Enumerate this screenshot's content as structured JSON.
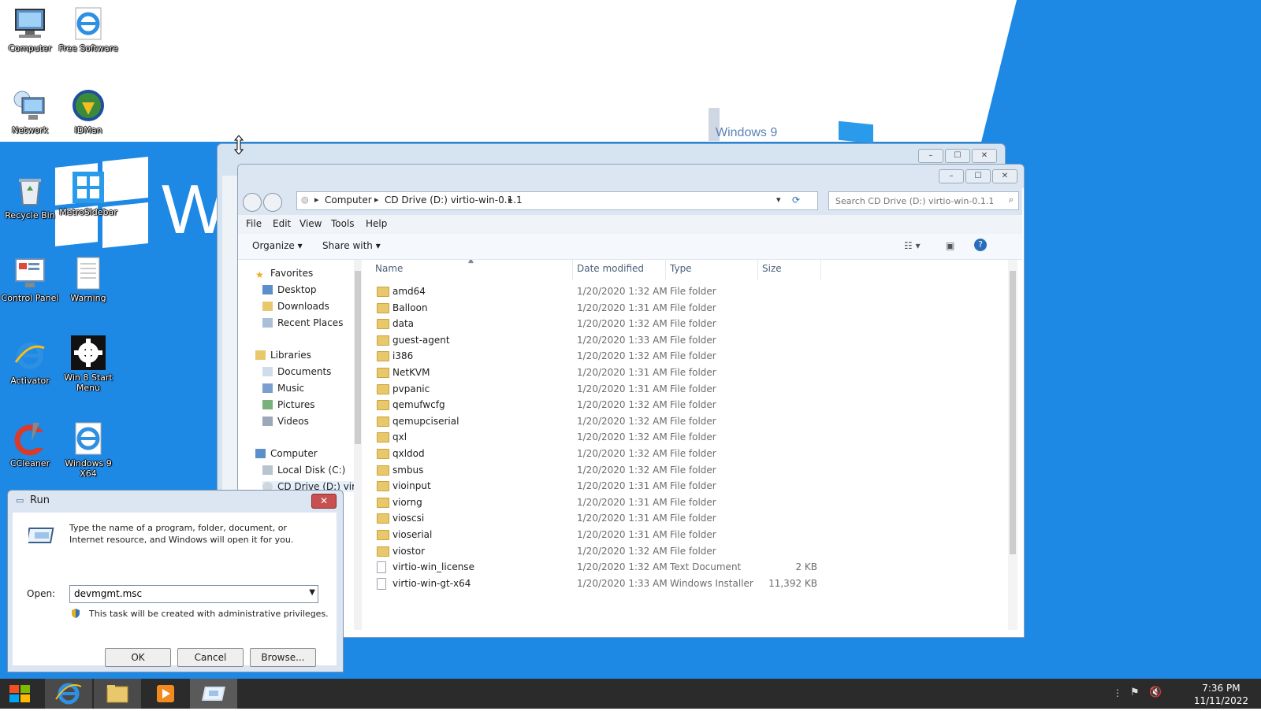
{
  "desktop": {
    "wallpaper_text": "W",
    "wallpaper_card_text": "Windows 9",
    "icons": [
      {
        "label": "Computer",
        "icon": "computer-icon"
      },
      {
        "label": "Free Software",
        "icon": "ie-icon"
      },
      {
        "label": "Network",
        "icon": "network-icon"
      },
      {
        "label": "IDMan",
        "icon": "idm-icon"
      },
      {
        "label": "Recycle Bin",
        "icon": "recycle-bin-icon"
      },
      {
        "label": "MetroSidebar",
        "icon": "metro-sidebar-icon"
      },
      {
        "label": "Control Panel",
        "icon": "control-panel-icon"
      },
      {
        "label": "Warning",
        "icon": "text-document-icon"
      },
      {
        "label": "Activator",
        "icon": "ie-icon"
      },
      {
        "label": "Win 8 Start Menu",
        "icon": "gear-icon"
      },
      {
        "label": "CCleaner",
        "icon": "ccleaner-icon"
      },
      {
        "label": "Windows 9 X64",
        "icon": "ie-icon"
      }
    ]
  },
  "explorer": {
    "breadcrumb": [
      "Computer",
      "CD Drive (D:) virtio-win-0.1.1"
    ],
    "search_placeholder": "Search CD Drive (D:) virtio-win-0.1.1",
    "menu": [
      "File",
      "Edit",
      "View",
      "Tools",
      "Help"
    ],
    "commands": {
      "organize": "Organize",
      "share_with": "Share with"
    },
    "nav": {
      "favorites": "Favorites",
      "favorites_items": [
        "Desktop",
        "Downloads",
        "Recent Places"
      ],
      "libraries": "Libraries",
      "libraries_items": [
        "Documents",
        "Music",
        "Pictures",
        "Videos"
      ],
      "computer": "Computer",
      "computer_items": [
        "Local Disk (C:)",
        "CD Drive (D:) virt"
      ]
    },
    "columns": {
      "name": "Name",
      "date": "Date modified",
      "type": "Type",
      "size": "Size"
    },
    "files": [
      {
        "name": "amd64",
        "date": "1/20/2020 1:32 AM",
        "type": "File folder",
        "size": ""
      },
      {
        "name": "Balloon",
        "date": "1/20/2020 1:31 AM",
        "type": "File folder",
        "size": ""
      },
      {
        "name": "data",
        "date": "1/20/2020 1:32 AM",
        "type": "File folder",
        "size": ""
      },
      {
        "name": "guest-agent",
        "date": "1/20/2020 1:33 AM",
        "type": "File folder",
        "size": ""
      },
      {
        "name": "i386",
        "date": "1/20/2020 1:32 AM",
        "type": "File folder",
        "size": ""
      },
      {
        "name": "NetKVM",
        "date": "1/20/2020 1:31 AM",
        "type": "File folder",
        "size": ""
      },
      {
        "name": "pvpanic",
        "date": "1/20/2020 1:31 AM",
        "type": "File folder",
        "size": ""
      },
      {
        "name": "qemufwcfg",
        "date": "1/20/2020 1:32 AM",
        "type": "File folder",
        "size": ""
      },
      {
        "name": "qemupciserial",
        "date": "1/20/2020 1:32 AM",
        "type": "File folder",
        "size": ""
      },
      {
        "name": "qxl",
        "date": "1/20/2020 1:32 AM",
        "type": "File folder",
        "size": ""
      },
      {
        "name": "qxldod",
        "date": "1/20/2020 1:32 AM",
        "type": "File folder",
        "size": ""
      },
      {
        "name": "smbus",
        "date": "1/20/2020 1:32 AM",
        "type": "File folder",
        "size": ""
      },
      {
        "name": "vioinput",
        "date": "1/20/2020 1:31 AM",
        "type": "File folder",
        "size": ""
      },
      {
        "name": "viorng",
        "date": "1/20/2020 1:31 AM",
        "type": "File folder",
        "size": ""
      },
      {
        "name": "vioscsi",
        "date": "1/20/2020 1:31 AM",
        "type": "File folder",
        "size": ""
      },
      {
        "name": "vioserial",
        "date": "1/20/2020 1:31 AM",
        "type": "File folder",
        "size": ""
      },
      {
        "name": "viostor",
        "date": "1/20/2020 1:32 AM",
        "type": "File folder",
        "size": ""
      },
      {
        "name": "virtio-win_license",
        "date": "1/20/2020 1:32 AM",
        "type": "Text Document",
        "size": "2 KB"
      },
      {
        "name": "virtio-win-gt-x64",
        "date": "1/20/2020 1:33 AM",
        "type": "Windows Installer",
        "size": "11,392 KB"
      }
    ]
  },
  "run_dialog": {
    "title": "Run",
    "description": "Type the name of a program, folder, document, or Internet resource, and Windows will open it for you.",
    "open_label": "Open:",
    "open_value": "devmgmt.msc",
    "admin_note": "This task will be created with administrative privileges.",
    "ok": "OK",
    "cancel": "Cancel",
    "browse": "Browse..."
  },
  "taskbar": {
    "items": [
      "start-button",
      "internet-explorer",
      "file-explorer",
      "media-player",
      "run"
    ],
    "time": "7:36 PM",
    "date": "11/11/2022"
  },
  "colors": {
    "wallpaper_blue": "#1e88e5",
    "taskbar": "#2b2b2b",
    "window_chrome": "#dbe6f2",
    "folder": "#e8c86a"
  }
}
